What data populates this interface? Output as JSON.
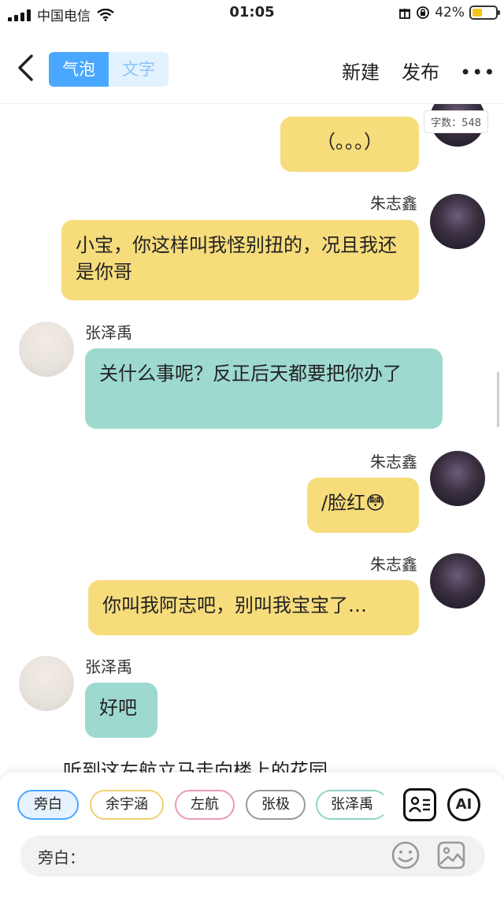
{
  "status_bar": {
    "carrier": "中国电信",
    "time": "01:05",
    "battery": "42%",
    "battery_level": 0.42
  },
  "nav": {
    "segment_bubble": "气泡",
    "segment_text": "文字",
    "new_label": "新建",
    "publish_label": "发布",
    "more_label": "•••"
  },
  "chat": {
    "word_count": "字数：548",
    "messages": [
      {
        "speaker": "",
        "text": "（。。。）"
      },
      {
        "speaker": "朱志鑫",
        "text": "小宝，你这样叫我怪别扭的，况且我还是你哥"
      },
      {
        "speaker": "张泽禹",
        "text": "关什么事呢？反正后天都要把你办了"
      },
      {
        "speaker": "朱志鑫",
        "text": "/脸红😳"
      },
      {
        "speaker": "朱志鑫",
        "text": "你叫我阿志吧，别叫我宝宝了…"
      },
      {
        "speaker": "张泽禹",
        "text": "好吧"
      }
    ],
    "narration": "听到这左航立马走向楼上的花园"
  },
  "composer": {
    "characters": [
      "旁白",
      "余宇涵",
      "左航",
      "张极",
      "张泽禹"
    ],
    "ai_label": "AI",
    "input_label": "旁白："
  },
  "colors": {
    "accent": "#4aa7ff",
    "yellow_bubble": "#f7dc7c",
    "teal_bubble": "#9ed9d0"
  }
}
